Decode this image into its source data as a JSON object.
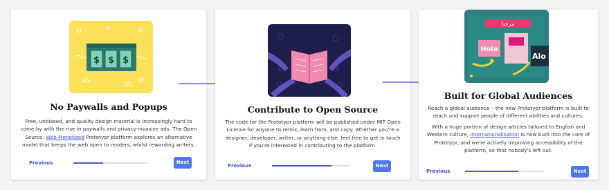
{
  "steps": [
    {
      "title": "No Paywalls and Popups",
      "desc_before": "Free, unbiased, and quality design material is increasingly hard to come by with the rise in paywalls and privacy-invasive ads. The Open Source, ",
      "desc_link": "Web Monetized",
      "desc_after": " Prototypr platform explores an alternative model that keeps the web open to readers, whilst rewarding writers.",
      "previous_label": "Previous",
      "next_label": "Next",
      "progress": 0.4
    },
    {
      "title": "Contribute to Open Source",
      "desc": "The code for the Prototypr platform will be published under MIT Open License for anyone to remix, learn from, and copy. Whether you're a designer, developer, writer, or anything else, feel free to get in touch if you're interested in contributing to the platform.",
      "previous_label": "Previous",
      "next_label": "Next",
      "progress": 0.76
    },
    {
      "title": "Built for Global Audiences",
      "desc_p1": "Reach a global audience – the new Prototypr platform is built to reach and support people of different abilities and cultures.",
      "desc_p2_before": "With a huge portion of design articles tailored to English and Western culture, ",
      "desc_p2_link": "internationalisation",
      "desc_p2_after": " is now built into the core of Prototypr, and we're actively improving accessibility of the platform, so that nobody's left out.",
      "previous_label": "Previous",
      "next_label": "Next",
      "progress": 0.68,
      "illustration_words": {
        "arabic": "مرحبا",
        "spanish": "Hola",
        "other": "Alo"
      }
    }
  ],
  "colors": {
    "accent": "#4f77e8",
    "link": "#3b4fd0",
    "arrow": "#4b3fd8"
  }
}
